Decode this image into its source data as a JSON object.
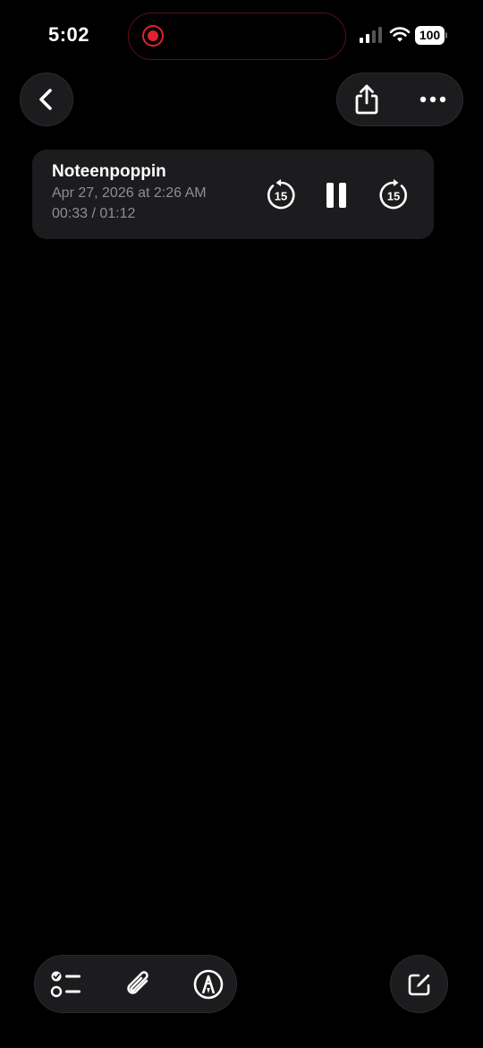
{
  "status_bar": {
    "time": "5:02",
    "battery": "100",
    "recording_color": "#e0222d"
  },
  "nav": {
    "back_icon": "chevron-left-icon",
    "share_icon": "share-icon",
    "more_icon": "ellipsis-icon"
  },
  "audio": {
    "title": "Noteenpoppin",
    "date": "Apr 27, 2026 at 2:26 AM",
    "elapsed": "00:33",
    "duration": "01:12",
    "time_display": "00:33 / 01:12",
    "skip_seconds": "15",
    "state": "playing"
  },
  "toolbar": {
    "checklist_icon": "checklist-icon",
    "attach_icon": "paperclip-icon",
    "markup_icon": "markup-icon",
    "compose_icon": "compose-icon"
  },
  "colors": {
    "background": "#000000",
    "card": "#1c1c1e",
    "secondary_text": "#8e8e93"
  }
}
